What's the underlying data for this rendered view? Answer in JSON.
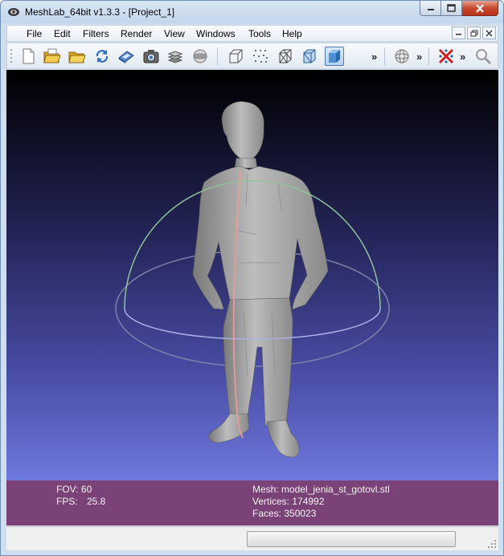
{
  "window": {
    "title": "MeshLab_64bit v1.3.3 - [Project_1]"
  },
  "menubar": {
    "items": [
      "File",
      "Edit",
      "Filters",
      "Render",
      "View",
      "Windows",
      "Tools",
      "Help"
    ]
  },
  "toolbar": {
    "icons": [
      "new-document-icon",
      "open-folder-icon",
      "open-project-icon",
      "reload-icon",
      "export-mesh-icon",
      "snapshot-icon",
      "layers-icon",
      "trackball-icon",
      "bounding-box-icon",
      "points-icon",
      "wireframe-icon",
      "hidden-lines-icon",
      "flat-shading-icon",
      "sphere-grid-icon",
      "delete-icon",
      "search-icon"
    ],
    "overflow_label": "»"
  },
  "viewport_info": {
    "fov_label": "FOV: 60",
    "fps_label": "FPS:",
    "fps_value": "25.8",
    "mesh_label": "Mesh: model_jenia_st_gotovl.stl",
    "vertices_label": "Vertices: 174992",
    "faces_label": "Faces: 350023"
  },
  "colors": {
    "viewport_top": "#000000",
    "viewport_bottom": "#6f78dd",
    "info_bar": "#7a4277",
    "trackball_green": "#8fc39a",
    "trackball_red": "#e79b9b",
    "trackball_blue": "#aab0e6"
  }
}
